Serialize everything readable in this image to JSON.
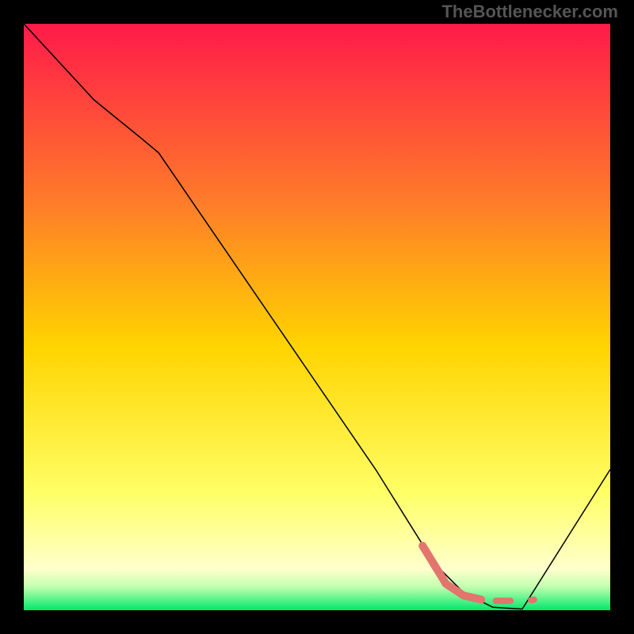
{
  "watermark": "TheBottlenecker.com",
  "chart_data": {
    "type": "line",
    "title": "",
    "xlabel": "",
    "ylabel": "",
    "xlim": [
      0,
      100
    ],
    "ylim": [
      0,
      100
    ],
    "background_gradient": {
      "stops": [
        {
          "offset": 0.0,
          "color": "#ff1a4a"
        },
        {
          "offset": 0.3,
          "color": "#ff7a2a"
        },
        {
          "offset": 0.55,
          "color": "#ffd400"
        },
        {
          "offset": 0.8,
          "color": "#ffff66"
        },
        {
          "offset": 0.93,
          "color": "#ffffcc"
        },
        {
          "offset": 0.96,
          "color": "#c3ffb0"
        },
        {
          "offset": 1.0,
          "color": "#00e86b"
        }
      ]
    },
    "series": [
      {
        "name": "curve",
        "stroke": "#000000",
        "stroke_width": 1.5,
        "points": [
          {
            "x": 0,
            "y": 100
          },
          {
            "x": 12,
            "y": 87
          },
          {
            "x": 20,
            "y": 80.5
          },
          {
            "x": 23,
            "y": 78
          },
          {
            "x": 60,
            "y": 24
          },
          {
            "x": 70,
            "y": 8
          },
          {
            "x": 75,
            "y": 3
          },
          {
            "x": 80,
            "y": 0.5
          },
          {
            "x": 85,
            "y": 0.2
          },
          {
            "x": 100,
            "y": 24
          }
        ]
      },
      {
        "name": "highlight",
        "stroke": "#e2756d",
        "stroke_width": 10,
        "linecap": "round",
        "points": [
          {
            "x": 68,
            "y": 11
          },
          {
            "x": 72,
            "y": 4.5
          },
          {
            "x": 75,
            "y": 2.5
          },
          {
            "x": 78,
            "y": 1.8
          }
        ]
      },
      {
        "name": "highlight-dash1",
        "stroke": "#e2756d",
        "stroke_width": 8,
        "linecap": "round",
        "points": [
          {
            "x": 80.5,
            "y": 1.6
          },
          {
            "x": 83,
            "y": 1.6
          }
        ]
      },
      {
        "name": "highlight-dot",
        "stroke": "#e2756d",
        "stroke_width": 8,
        "linecap": "round",
        "points": [
          {
            "x": 86.5,
            "y": 1.7
          },
          {
            "x": 87,
            "y": 1.8
          }
        ]
      }
    ]
  }
}
